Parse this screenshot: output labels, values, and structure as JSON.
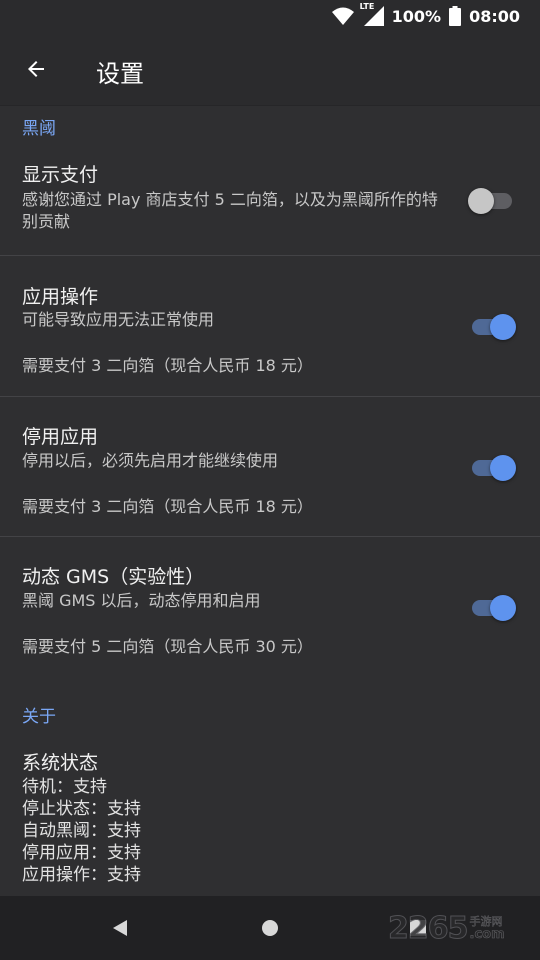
{
  "status_bar": {
    "battery": "100%",
    "time": "08:00",
    "network": "LTE",
    "icons": [
      "wifi-icon",
      "cell-signal-icon",
      "battery-icon"
    ]
  },
  "app_bar": {
    "title": "设置",
    "back_icon": "arrow-back-icon"
  },
  "sections": {
    "black_gate": {
      "header": "黑阈",
      "show_payment": {
        "title": "显示支付",
        "summary": "感谢您通过 Play 商店支付 5 二向箔，以及为黑阈所作的特别贡献",
        "enabled": false
      },
      "app_ops": {
        "title": "应用操作",
        "summary": "可能导致应用无法正常使用",
        "price": "需要支付 3 二向箔（现合人民币 18 元）",
        "enabled": true
      },
      "disable_apps": {
        "title": "停用应用",
        "summary": "停用以后，必须先启用才能继续使用",
        "price": "需要支付 3 二向箔（现合人民币 18 元）",
        "enabled": true
      },
      "dynamic_gms": {
        "title": "动态 GMS（实验性）",
        "summary": "黑阈 GMS 以后，动态停用和启用",
        "price": "需要支付 5 二向箔（现合人民币 30 元）",
        "enabled": true
      }
    },
    "about": {
      "header": "关于",
      "system_status": {
        "title": "系统状态",
        "lines": [
          "待机：支持",
          "停止状态：支持",
          "自动黑阈：支持",
          "停用应用：支持",
          "应用操作：支持"
        ]
      }
    }
  },
  "nav_bar": {
    "icons": [
      "nav-back-icon",
      "nav-home-icon",
      "nav-recents-icon"
    ]
  },
  "watermark": {
    "number": "2265",
    "text_cn": "手游网",
    "text_com": ".com"
  },
  "colors": {
    "background": "#2f2f31",
    "accent": "#7aa7f5",
    "switch_on_thumb": "#5e93ee",
    "switch_on_track": "#4f6996",
    "switch_off_thumb": "#c6c6c6"
  }
}
